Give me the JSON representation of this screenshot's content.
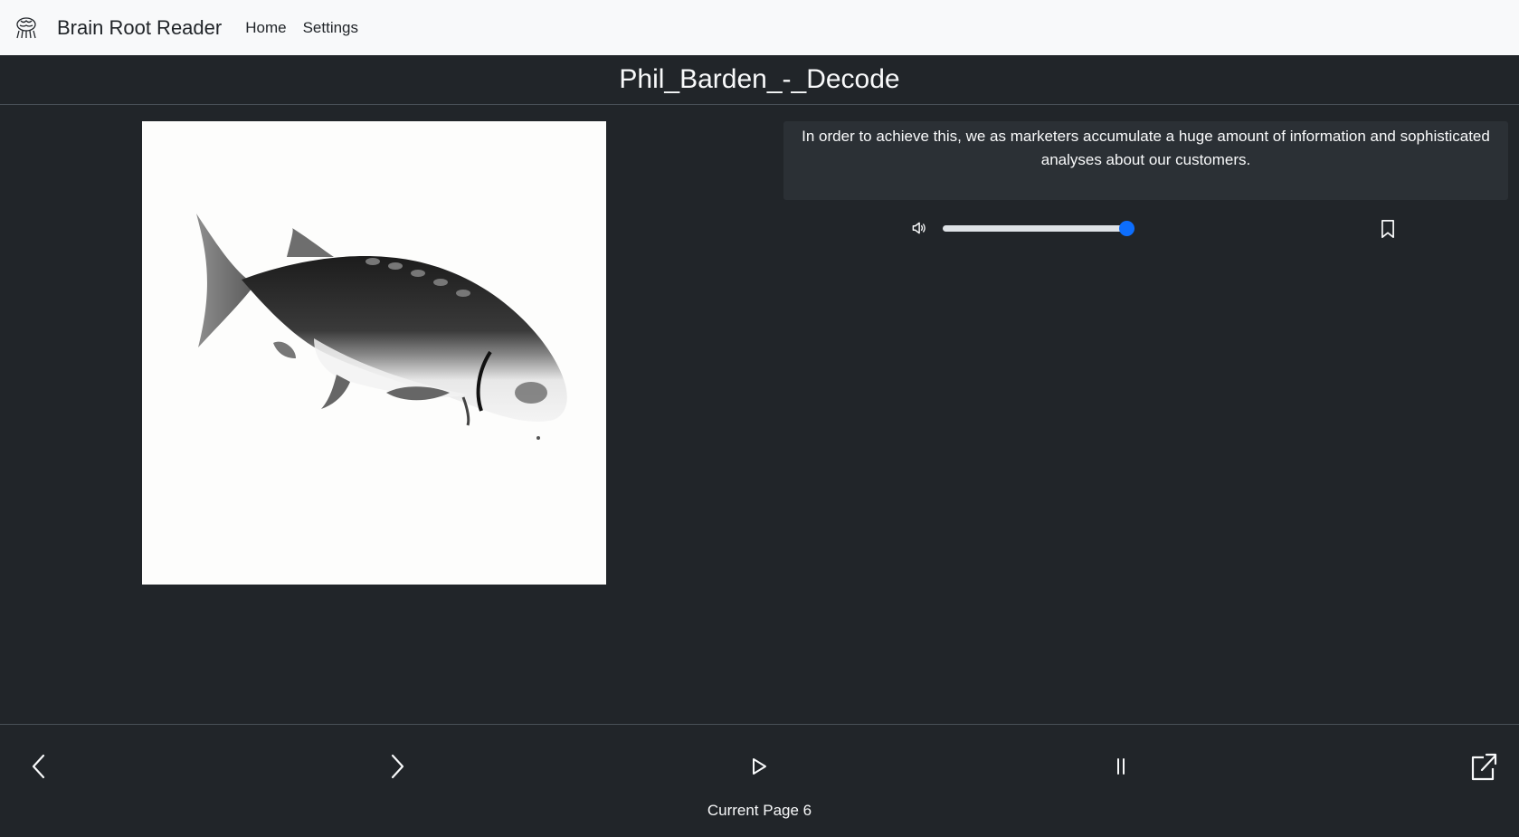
{
  "navbar": {
    "logo_icon": "brain-icon",
    "brand": "Brain Root Reader",
    "links": [
      "Home",
      "Settings"
    ]
  },
  "book": {
    "title": "Phil_Barden_-_Decode"
  },
  "reader": {
    "image_icon": "fish-illustration",
    "text": "In order to achieve this, we as marketers accumulate a huge amount of information and sophisticated analyses about our customers.",
    "volume_level": 0.97
  },
  "footer": {
    "current_page_label": "Current Page 6",
    "icons": [
      "chevron-left-icon",
      "chevron-right-icon",
      "play-icon",
      "pause-icon",
      "box-arrow-up-right-icon"
    ]
  },
  "colors": {
    "background": "#212529",
    "navbar": "#f8f9fa",
    "accent": "#0d6efd",
    "text_box": "#2b3035"
  }
}
